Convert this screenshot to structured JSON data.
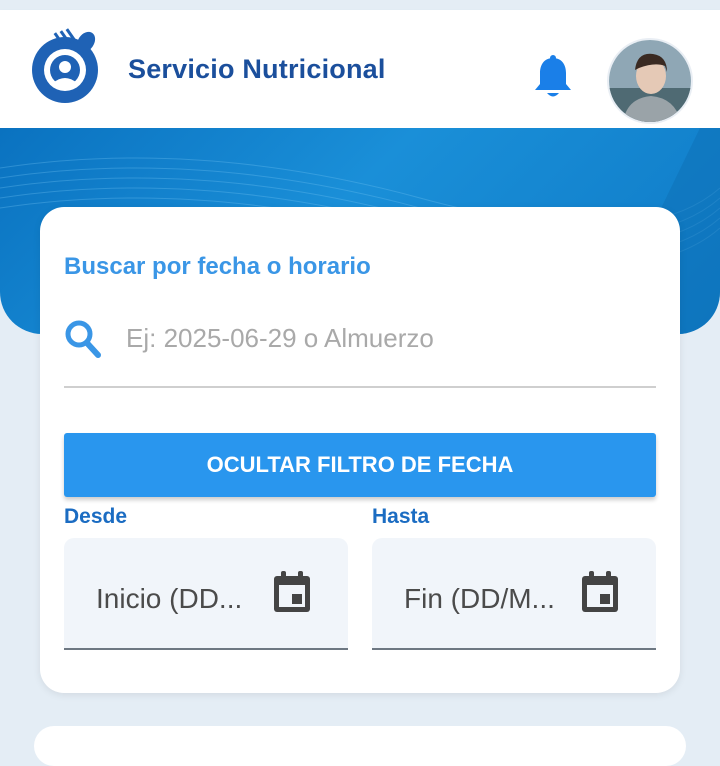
{
  "header": {
    "app_title": "Servicio Nutricional",
    "accent_color": "#1b4f9c",
    "logo_icon": "plate-with-utensils-logo",
    "notification_icon": "bell-icon",
    "avatar_icon": "user-avatar"
  },
  "search": {
    "label": "Buscar por fecha o horario",
    "placeholder": "Ej: 2025-06-29 o Almuerzo",
    "value": "",
    "icon": "search-icon"
  },
  "filter": {
    "toggle_label": "OCULTAR FILTRO DE FECHA",
    "button_color": "#2996ee",
    "from_label": "Desde",
    "from_placeholder": "Inicio (DD...",
    "to_label": "Hasta",
    "to_placeholder": "Fin (DD/M...",
    "calendar_icon": "calendar-icon"
  }
}
